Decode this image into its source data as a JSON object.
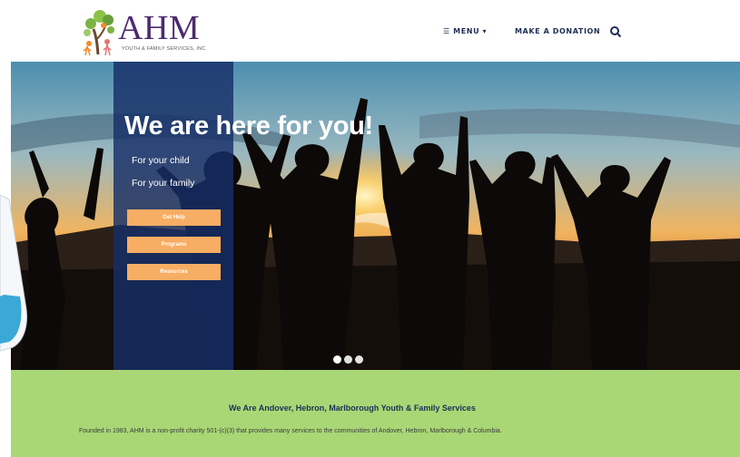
{
  "logo": {
    "name": "AHM",
    "subtitle": "YOUTH & FAMILY SERVICES, INC."
  },
  "nav": {
    "menu": "☰ MENU ▾",
    "donate": "MAKE A DONATION",
    "search_icon": "search-icon"
  },
  "hero": {
    "title": "We are here for you!",
    "line1": "For your child",
    "line2": "For your family",
    "buttons": [
      "Get Help",
      "Programs",
      "Resources"
    ],
    "slides": 3,
    "active_slide": 1,
    "panel_color": "#162e68",
    "button_color": "#f7ad63"
  },
  "intro": {
    "title": "We Are Andover, Hebron, Marlborough Youth & Family Services",
    "text": "Founded in 1983, AHM is a non-profit charity 501-(c)(3) that provides many services to the communities of Andover, Hebron, Marlborough & Columbia.",
    "background": "#a9d775"
  }
}
